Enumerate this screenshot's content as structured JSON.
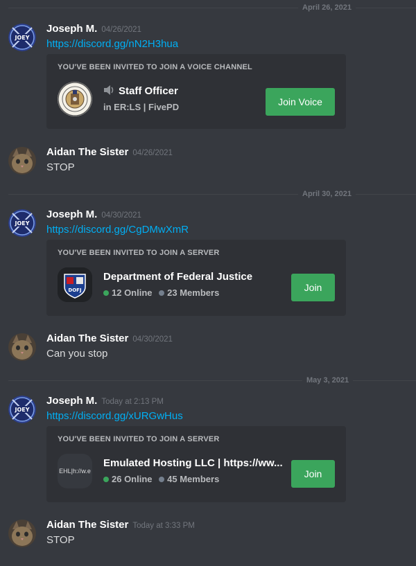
{
  "colors": {
    "background": "#36393f",
    "card": "#2f3136",
    "link": "#00aff4",
    "join_button": "#3ba55c",
    "online_dot": "#3ba55c",
    "members_dot": "#747f8d"
  },
  "dividers": [
    "April 26, 2021",
    "April 30, 2021",
    "May 3, 2021"
  ],
  "messages": [
    {
      "author": "Joseph M.",
      "timestamp": "04/26/2021",
      "avatar": "joey-avatar",
      "link": "https://discord.gg/nN2H3hua",
      "invite": {
        "heading": "YOU'VE BEEN INVITED TO JOIN A VOICE CHANNEL",
        "title": "Staff Officer",
        "subtitle": "in ER:LS | FivePD",
        "button": "Join Voice",
        "icon": "county-seal-icon"
      }
    },
    {
      "author": "Aidan The Sister",
      "timestamp": "04/26/2021",
      "avatar": "kitten-avatar",
      "text": "STOP"
    },
    {
      "author": "Joseph M.",
      "timestamp": "04/30/2021",
      "avatar": "joey-avatar",
      "link": "https://discord.gg/CgDMwXmR",
      "invite": {
        "heading": "YOU'VE BEEN INVITED TO JOIN A SERVER",
        "title": "Department of Federal Justice",
        "online": "12 Online",
        "members": "23 Members",
        "button": "Join",
        "icon": "dofj-logo-icon",
        "icon_text": "DOFJ"
      }
    },
    {
      "author": "Aidan The Sister",
      "timestamp": "04/30/2021",
      "avatar": "kitten-avatar",
      "text": "Can you stop"
    },
    {
      "author": "Joseph M.",
      "timestamp": "Today at 2:13 PM",
      "avatar": "joey-avatar",
      "link": "https://discord.gg/xURGwHus",
      "invite": {
        "heading": "YOU'VE BEEN INVITED TO JOIN A SERVER",
        "title": "Emulated Hosting LLC | https://ww...",
        "online": "26 Online",
        "members": "45 Members",
        "button": "Join",
        "icon": "server-initials-icon",
        "icon_text": "EHL|h://w.e"
      }
    },
    {
      "author": "Aidan The Sister",
      "timestamp": "Today at 3:33 PM",
      "avatar": "kitten-avatar",
      "text": "STOP"
    }
  ]
}
